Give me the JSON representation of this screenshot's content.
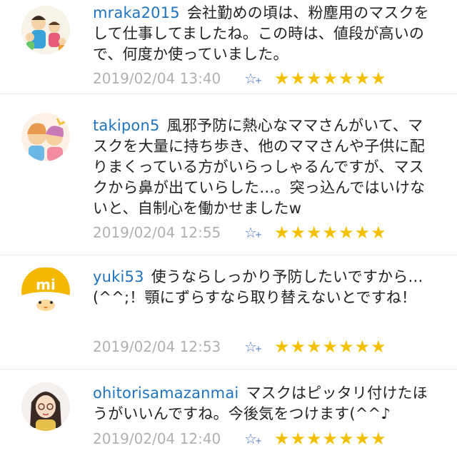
{
  "comments": [
    {
      "user": "mraka2015",
      "text": "会社勤めの頃は、粉塵用のマスクをして仕事してましたね。この時は、値段が高いので、何度か使っていました。",
      "time": "2019/02/04 13:40",
      "stars": "★★★★★★★"
    },
    {
      "user": "takipon5",
      "text": "風邪予防に熱心なママさんがいて、マスクを大量に持ち歩き、他のママさんや子供に配りまくっている方がいらっしゃるんですが、マスクから鼻が出ていらした…。突っ込んではいけないと、自制心を働かせましたw",
      "time": "2019/02/04 12:55",
      "stars": "★★★★★★★"
    },
    {
      "user": "yuki53",
      "text": "使うならしっかり予防したいですから…(^^;！顎にずらすなら取り替えないとですね！",
      "time": "2019/02/04 12:53",
      "stars": "★★★★★★★"
    },
    {
      "user": "ohitorisamazanmai",
      "text": "マスクはピッタリ付けたほうがいいんですね。今後気をつけます(^^♪",
      "time": "2019/02/04 12:40",
      "stars": "★★★★★★★"
    }
  ],
  "icons": {
    "add_star": "☆",
    "add_star_plus": "+"
  },
  "colors": {
    "username": "#1e73be",
    "timestamp": "#b0b0b0",
    "star": "#f3c000",
    "add_star": "#4a78c8"
  }
}
